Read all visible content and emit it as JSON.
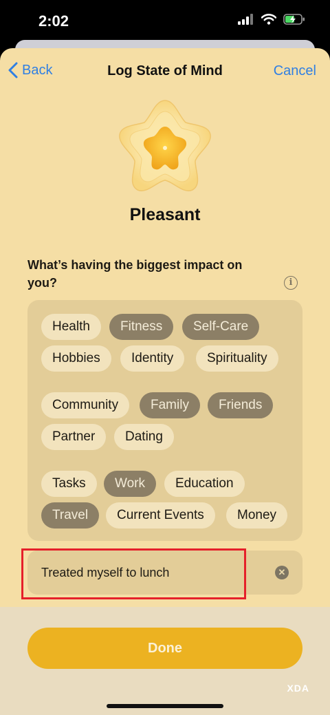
{
  "status_bar": {
    "time": "2:02"
  },
  "nav": {
    "back_label": "Back",
    "title": "Log State of Mind",
    "cancel_label": "Cancel"
  },
  "mood": {
    "label": "Pleasant"
  },
  "question": "What’s having the biggest impact on you?",
  "tags": [
    {
      "label": "Health",
      "selected": false
    },
    {
      "label": "Fitness",
      "selected": true
    },
    {
      "label": "Self-Care",
      "selected": true
    },
    {
      "label": "Hobbies",
      "selected": false
    },
    {
      "label": "Identity",
      "selected": false
    },
    {
      "label": "Spirituality",
      "selected": false
    },
    {
      "label": "Community",
      "selected": false
    },
    {
      "label": "Family",
      "selected": true
    },
    {
      "label": "Friends",
      "selected": true
    },
    {
      "label": "Partner",
      "selected": false
    },
    {
      "label": "Dating",
      "selected": false
    },
    {
      "label": "Tasks",
      "selected": false
    },
    {
      "label": "Work",
      "selected": true
    },
    {
      "label": "Education",
      "selected": false
    },
    {
      "label": "Travel",
      "selected": true
    },
    {
      "label": "Current Events",
      "selected": false
    },
    {
      "label": "Money",
      "selected": false
    }
  ],
  "note": {
    "value": "Treated myself to lunch"
  },
  "done_label": "Done",
  "watermark": "XDA",
  "colors": {
    "accent_blue": "#2f7fe3",
    "done_yellow": "#ecb221",
    "chip_selected": "#8c7f66",
    "highlight_red": "#e5202a"
  }
}
